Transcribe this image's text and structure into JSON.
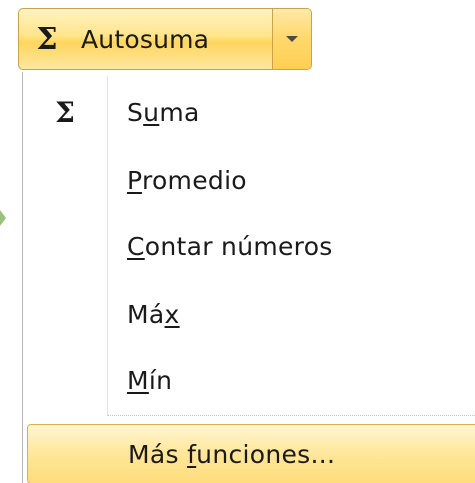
{
  "autosum_button": {
    "icon": "sigma-icon",
    "label": "Autosuma",
    "dropdown_icon": "chevron-down-icon"
  },
  "menu": {
    "items": [
      {
        "icon": "sigma-icon",
        "pre": "S",
        "key": "u",
        "post": "ma"
      },
      {
        "icon": "",
        "pre": "",
        "key": "P",
        "post": "romedio"
      },
      {
        "icon": "",
        "pre": "",
        "key": "C",
        "post": "ontar números"
      },
      {
        "icon": "",
        "pre": "Má",
        "key": "x",
        "post": ""
      },
      {
        "icon": "",
        "pre": "",
        "key": "M",
        "post": "ín"
      },
      {
        "icon": "",
        "pre": "Más ",
        "key": "f",
        "post": "unciones..."
      }
    ],
    "highlighted_index": 5
  },
  "colors": {
    "highlight_fill": "#ffe69a",
    "highlight_border": "#d8b04c",
    "text": "#1a1a1a"
  }
}
